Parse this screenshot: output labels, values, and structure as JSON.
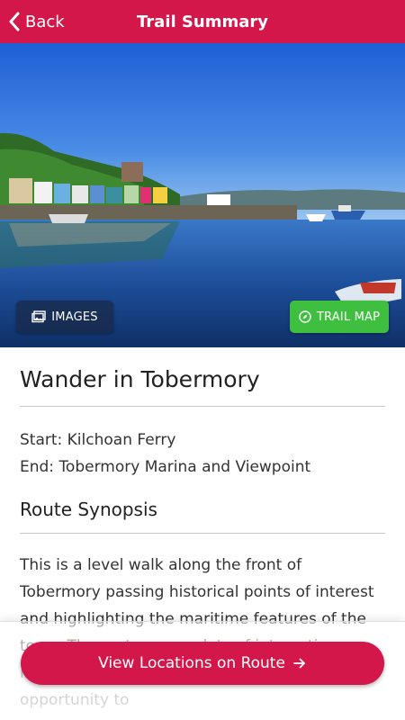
{
  "header": {
    "back_label": "Back",
    "title": "Trail Summary",
    "background": "#d4174a"
  },
  "hero": {
    "image": "harbour-photo",
    "images_button_label": "IMAGES",
    "trail_map_button_label": "TRAIL MAP",
    "trail_map_button_color": "#3fbf3f"
  },
  "trail": {
    "name": "Wander in Tobermory",
    "start": "Start: Kilchoan Ferry",
    "end": "End: Tobermory Marina and Viewpoint"
  },
  "synopsis": {
    "heading": "Route Synopsis",
    "text": "This is a level walk along the front of Tobermory passing historical points of interest and highlighting the maritime features of the town. The route passes lots of interesting independent shops providing you an opportunity to"
  },
  "cta": {
    "label": "View Locations on Route",
    "icon": "arrow-right-icon",
    "color": "#d4174a"
  }
}
